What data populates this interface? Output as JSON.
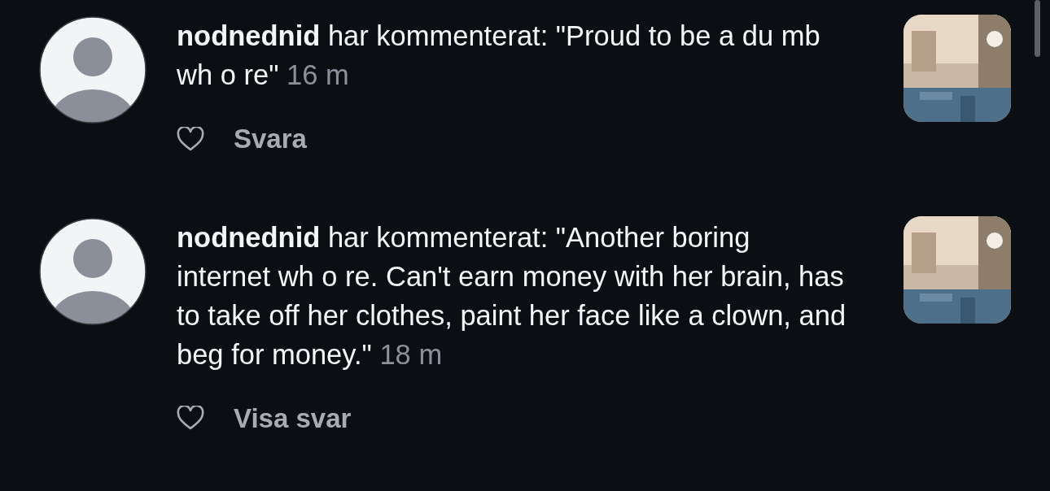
{
  "comments": [
    {
      "username": "nodnednid",
      "text": "har kommenterat: \"Proud to be a du mb wh o re\"",
      "time": "16 m",
      "liked": false,
      "action": "Svara"
    },
    {
      "username": "nodnednid",
      "text": "har kommenterat: \"Another boring internet wh o re. Can't earn money with her brain, has to take off her clothes, paint her face like a clown, and beg for money.\"",
      "time": "18 m",
      "liked": false,
      "action": "Visa svar"
    }
  ]
}
